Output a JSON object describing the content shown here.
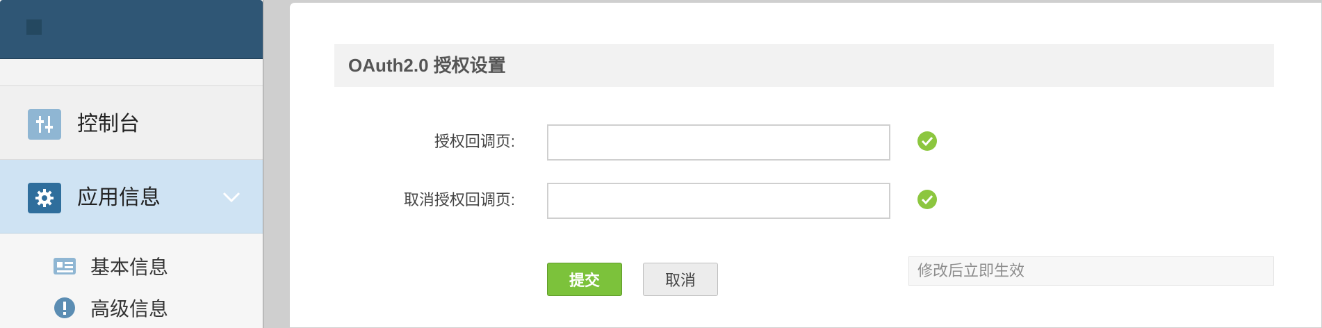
{
  "sidebar": {
    "items": [
      {
        "label": "控制台",
        "icon": "sliders-icon"
      },
      {
        "label": "应用信息",
        "icon": "gear-icon",
        "expanded": true
      }
    ],
    "sub_items": [
      {
        "label": "基本信息",
        "icon": "id-card-icon"
      },
      {
        "label": "高级信息",
        "icon": "exclamation-icon"
      }
    ]
  },
  "main": {
    "section_title": "OAuth2.0 授权设置",
    "fields": [
      {
        "label": "授权回调页:",
        "value": "",
        "status": "valid"
      },
      {
        "label": "取消授权回调页:",
        "value": "",
        "status": "valid"
      }
    ],
    "submit_label": "提交",
    "cancel_label": "取消",
    "hint": "修改后立即生效"
  },
  "colors": {
    "header": "#2f5675",
    "active_item": "#cfe3f3",
    "submit": "#7cc23b",
    "check": "#8cc63f"
  }
}
